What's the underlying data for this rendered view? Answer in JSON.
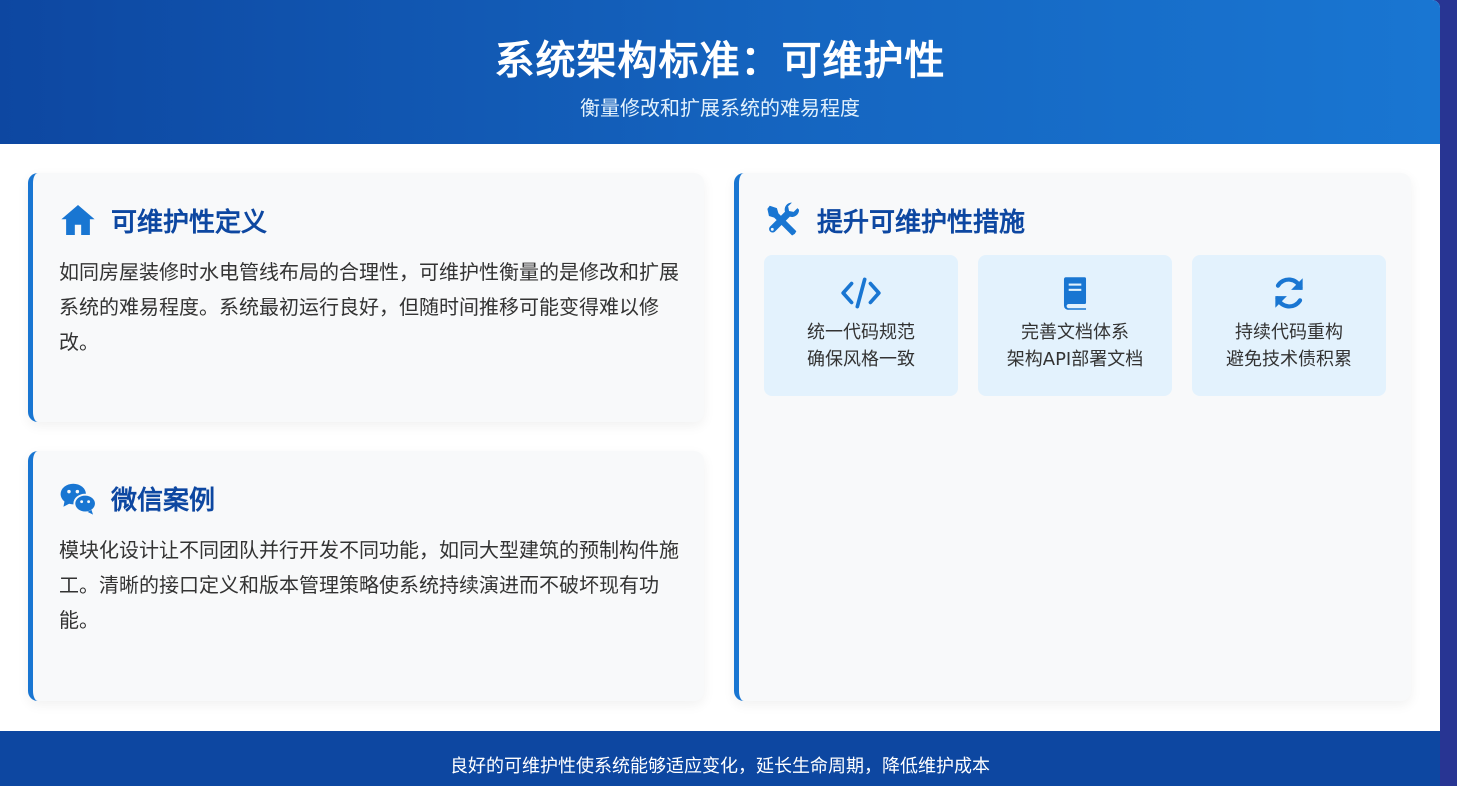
{
  "header": {
    "title": "系统架构标准：可维护性",
    "subtitle": "衡量修改和扩展系统的难易程度"
  },
  "definition_card": {
    "icon": "house-icon",
    "title": "可维护性定义",
    "text": "如同房屋装修时水电管线布局的合理性，可维护性衡量的是修改和扩展系统的难易程度。系统最初运行良好，但随时间推移可能变得难以修改。"
  },
  "wechat_card": {
    "icon": "wechat-icon",
    "title": "微信案例",
    "text": "模块化设计让不同团队并行开发不同功能，如同大型建筑的预制构件施工。清晰的接口定义和版本管理策略使系统持续演进而不破坏现有功能。"
  },
  "measures_card": {
    "icon": "tools-icon",
    "title": "提升可维护性措施",
    "items": [
      {
        "icon": "code-icon",
        "line1": "统一代码规范",
        "line2": "确保风格一致"
      },
      {
        "icon": "book-icon",
        "line1": "完善文档体系",
        "line2": "架构API部署文档"
      },
      {
        "icon": "refresh-icon",
        "line1": "持续代码重构",
        "line2": "避免技术债积累"
      }
    ]
  },
  "footer": {
    "text": "良好的可维护性使系统能够适应变化，延长生命周期，降低维护成本"
  },
  "colors": {
    "primary": "#0d47a1",
    "accent": "#1976d2",
    "tile_bg": "#e3f2fd",
    "card_bg": "#f8f9fa"
  }
}
